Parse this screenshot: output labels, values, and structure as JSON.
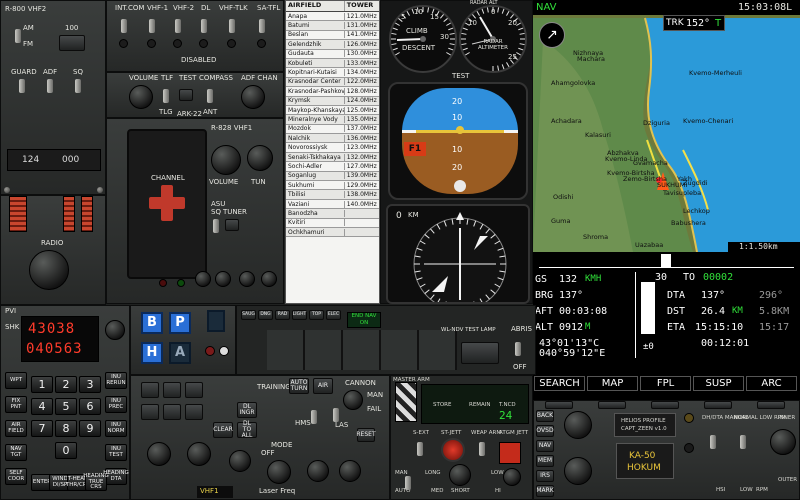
{
  "radio_r800": {
    "title": "R-800 VHF2",
    "am_label": "AM",
    "fm_label": "FM",
    "freq_100": "100",
    "mode_guard": "GUARD",
    "mode_adf": "ADF",
    "mode_sq": "SQ",
    "display_left": "124",
    "display_right": "000",
    "radio_label": "RADIO"
  },
  "intercom": {
    "buttons": [
      "INT.COM",
      "VHF-1",
      "VHF-2",
      "DL",
      "VHF-TLK",
      "SA-TFL"
    ],
    "disabled_label": "DISABLED"
  },
  "adf": {
    "volume": "VOLUME",
    "tlf": "TLF",
    "test": "TEST",
    "compass": "COMPASS",
    "adf_chan": "ADF CHAN",
    "tlg": "TLG",
    "ant": "ANT",
    "model": "ARK-22"
  },
  "r828": {
    "title": "R-828 VHF1",
    "channel": "CHANNEL",
    "volume": "VOLUME",
    "tun": "TUN",
    "asu": "ASU",
    "sq": "SQ",
    "tuner": "TUNER",
    "sq_off": "OFF",
    "sq_on": "ON"
  },
  "airfields": {
    "col_airfield": "AIRFIELD",
    "col_tower": "TOWER",
    "rows": [
      [
        "Anapa",
        "121.0MHz"
      ],
      [
        "Batumi",
        "131.0MHz"
      ],
      [
        "Beslan",
        "141.0MHz"
      ],
      [
        "Gelendzhik",
        "126.0MHz"
      ],
      [
        "Gudauta",
        "130.0MHz"
      ],
      [
        "Kobuleti",
        "133.0MHz"
      ],
      [
        "Kopitnari-Kutaisi",
        "134.0MHz"
      ],
      [
        "Krasnodar Center",
        "122.0MHz"
      ],
      [
        "Krasnodar-Pashkov.",
        "128.0MHz"
      ],
      [
        "Krymsk",
        "124.0MHz"
      ],
      [
        "Maykop-Khanskaya",
        "125.0MHz"
      ],
      [
        "Mineralnye Vody",
        "135.0MHz"
      ],
      [
        "Mozdok",
        "137.0MHz"
      ],
      [
        "Nalchik",
        "136.0MHz"
      ],
      [
        "Novorossiysk",
        "123.0MHz"
      ],
      [
        "Senaki-Tskhakaya",
        "132.0MHz"
      ],
      [
        "Sochi-Adler",
        "127.0MHz"
      ],
      [
        "Soganlug",
        "139.0MHz"
      ],
      [
        "Sukhumi",
        "129.0MHz"
      ],
      [
        "Tbilisi",
        "138.0MHz"
      ],
      [
        "Vaziani",
        "140.0MHz"
      ],
      [
        "Banodzha",
        ""
      ],
      [
        "Kvitiri",
        ""
      ],
      [
        "Ochkhamuri",
        ""
      ]
    ]
  },
  "gauges": {
    "vsi_climb": "CLIMB",
    "vsi_descent": "DESCENT",
    "radalt_title": "RADAR ALTIMETER",
    "radalt_top": "RADAR ALT",
    "vsi_marks": [
      "5",
      "10",
      "15",
      "30"
    ],
    "alt_marks": [
      "0",
      "10",
      "20",
      "25"
    ],
    "adi_pitch": [
      "20",
      "10",
      "10",
      "20"
    ],
    "adi_flag": "F1",
    "hsi_top": "0",
    "hsi_km": "KM",
    "test_lbl": "TEST",
    "hsi_marks": [
      "N",
      "3",
      "6",
      "E",
      "12",
      "15",
      "S",
      "21",
      "24",
      "W",
      "30",
      "33"
    ]
  },
  "map_header": {
    "mode": "NAV",
    "time": "15:03:08L",
    "range_top": "1:1.50km",
    "track_prefix": "TRK",
    "track_value": "152°",
    "track_suffix": "T",
    "wp_number": "3D"
  },
  "map_places": [
    "Nizhnaya",
    "Machara",
    "Ahamgolovka",
    "Kvemo-Merheuli",
    "Kvemo-Chenari",
    "Achadara",
    "Dziguria",
    "Kalasuri",
    "Kvemo-Linda",
    "Abzhakva",
    "Gvamacha",
    "Zemo-Birtsha",
    "Yakh",
    "Zugdidi",
    "SUKHUMI",
    "Kvemo-Birtsha",
    "Tavisupleba",
    "Lechkop",
    "Odishi",
    "Babushera",
    "Uazabaa",
    "Shroma",
    "Guma"
  ],
  "pvi": {
    "gs_label": "GS",
    "gs_value": "132",
    "gs_unit": "KMH",
    "brg_label": "BRG",
    "brg_value": "137°",
    "aft_label": "AFT",
    "aft_value": "00:03:08",
    "alt_label": "ALT",
    "alt_value": "0912",
    "alt_unit": "M",
    "lat": "43°01'13\"C",
    "lon": "040°59'12\"E",
    "err": "±0",
    "wp_from": "30",
    "to_label": "TO",
    "wp_to": "00002",
    "dta_label": "DTA",
    "dta_value": "137°",
    "dta_alt": "296°",
    "dst_label": "DST",
    "dst_value": "26.4",
    "dst_unit": "KM",
    "dst_alt": "5.8KM",
    "eta_label": "ETA",
    "eta_value": "15:15:10",
    "eta_alt": "15:17",
    "ete_value": "00:12:01",
    "vert_label": "VAL"
  },
  "nav_buttons": [
    "SEARCH",
    "MAP",
    "FPL",
    "SUSP",
    "ARC"
  ],
  "nav_side": [
    "BACK",
    "OVSD",
    "NAV",
    "MEM",
    "IRS",
    "MARK"
  ],
  "datalink": {
    "title": "ABRIS",
    "off": "OFF",
    "buttons": [
      "SAUG",
      "DNG",
      "RAD",
      "LIGHT",
      "TOP",
      "ELEC"
    ],
    "end_label": "END NAV ON",
    "wl_label": "WL-NDV TEST LAMP"
  },
  "pvi_keypad": {
    "display_top": "43038",
    "display_bottom": "040563",
    "pvi_label": "PVI",
    "shk_label": "SHK",
    "left_keys": [
      "WPT",
      "FIX PNT",
      "AIR FIELD",
      "NAV TGT",
      "SELF COOR"
    ],
    "digits": [
      "1",
      "2",
      "3",
      "4",
      "5",
      "6",
      "7",
      "8",
      "9",
      "0"
    ],
    "bottom_keys": [
      "ENTER",
      "WIND DI/SP",
      "T-HEAD THR/CRS",
      "HEADING TRUE CRS"
    ],
    "right_keys": [
      "INU RERUN",
      "INU PREC",
      "INU NORM",
      "INU TEST",
      "HEADING DTA"
    ],
    "clear_label": "CLR",
    "reset_label": "RESET",
    "on_label": "ON"
  },
  "datalink_keys": {
    "b": "B",
    "p": "P",
    "h": "H",
    "a": "A"
  },
  "target_panel": {
    "training": "TRAINING",
    "auto_turn": "AUTO TURN",
    "air": "AIR",
    "cannon": "CANNON",
    "man": "MAN",
    "fail": "FAIL",
    "reset": "RESET",
    "clear": "CLEAR",
    "dl_ingr": "DL INGR",
    "dl_to_all": "DL TO ALL",
    "hms": "HMS",
    "las": "LAS",
    "fl_sc": "FLS CC",
    "mode": "MODE",
    "off": "OFF",
    "laser_freq": "Laser Freq",
    "vhf1": "VHF1",
    "ch": "CH"
  },
  "weapons": {
    "master_arm": "MASTER ARM",
    "store": "STORE",
    "remain": "REMAIN",
    "t_ncd": "T.NCD",
    "count": "24",
    "s_ext": "S-EXT",
    "st_jett": "ST-JETT",
    "weap_arm": "WEAP ARM",
    "atgm_jett": "ATGM JETT",
    "man": "MAN",
    "auto": "AUTO",
    "low": "LOW",
    "long": "LONG",
    "med": "MED",
    "short": "SHORT",
    "hi": "HI"
  },
  "helios": {
    "line1": "HELIOS PROFILE",
    "line2": "CAPT_ZEEN v1.0",
    "aircraft": "KA-50",
    "name": "HOKUM"
  },
  "hsi_bottom": {
    "labels": [
      "DH/DTA MANUAL",
      "NORMAL LOW RPM",
      "INNER",
      "OUTER",
      "HSI",
      "LOW",
      "RPM",
      "MIN",
      "BAR"
    ]
  },
  "colors": {
    "nav_green": "#31e03a",
    "segment_red": "#ff3b2b",
    "label_yellow": "#e8d24a",
    "sky": "#2f8fdc",
    "ground": "#9a5c22",
    "lamp_blue": "#2a6fd6"
  }
}
